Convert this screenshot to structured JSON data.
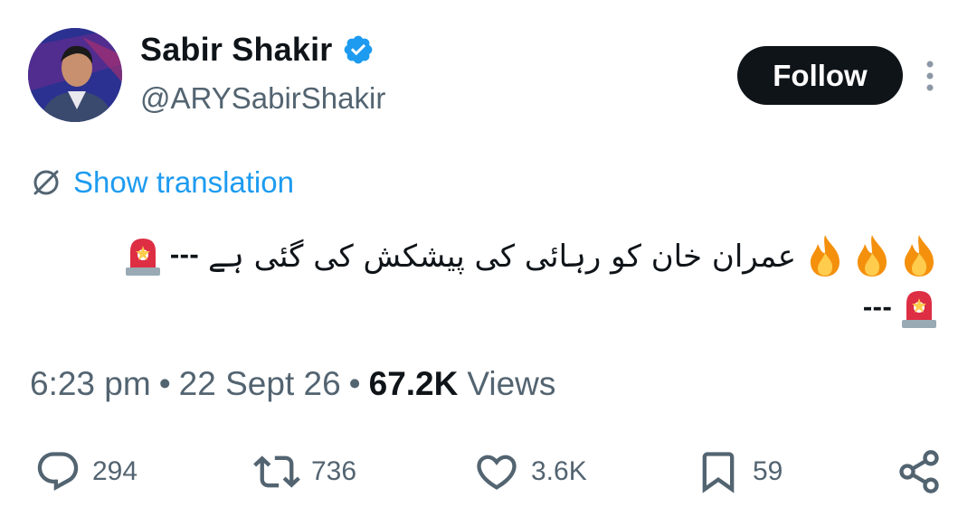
{
  "author": {
    "display_name": "Sabir Shakir",
    "handle": "@ARYSabirShakir",
    "avatar_icon": "profile-photo"
  },
  "header": {
    "follow_label": "Follow"
  },
  "translation": {
    "label": "Show translation"
  },
  "tweet": {
    "text": "عمران خان کو رہائی کی پیشکش کی گئی ہے",
    "dashes_line1": "---",
    "dashes_line2": "---",
    "emojis": [
      "fire-emoji",
      "fire-emoji",
      "fire-emoji",
      "police-light-emoji",
      "police-light-emoji"
    ]
  },
  "meta": {
    "time": "6:23 pm",
    "date": "22 Sept 26",
    "views_count": "67.2K",
    "views_label": "Views"
  },
  "actions": {
    "replies": "294",
    "reposts": "736",
    "likes": "3.6K",
    "bookmarks": "59"
  },
  "colors": {
    "link": "#1d9bf0",
    "muted": "#536471",
    "text": "#0f1419",
    "verified": "#1d9bf0"
  }
}
